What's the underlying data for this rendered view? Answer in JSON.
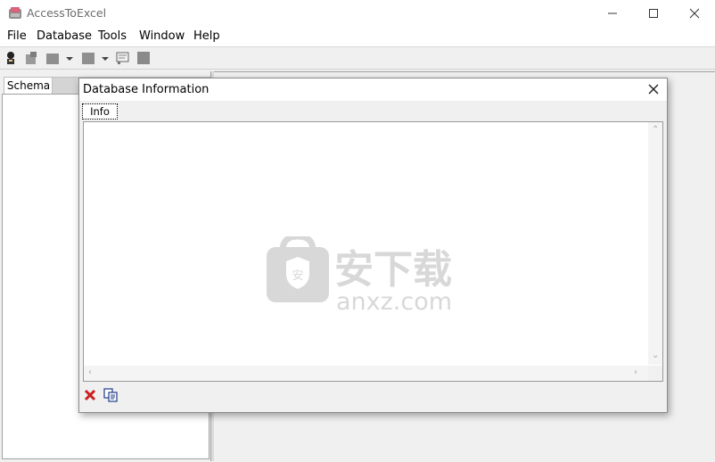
{
  "window": {
    "title": "AccessToExcel",
    "controls": [
      "minimize",
      "maximize",
      "close"
    ]
  },
  "menu": {
    "items": [
      "File",
      "Database",
      "Tools",
      "Window",
      "Help"
    ]
  },
  "toolbar": {
    "icons": [
      "connect-icon",
      "disconnect-icon",
      "open-icon",
      "save-icon",
      "properties-icon",
      "stop-icon"
    ]
  },
  "left_pane": {
    "tab_label": "Schema"
  },
  "dialog": {
    "title": "Database Information",
    "tab_label": "Info",
    "content": "",
    "footer_icons": [
      "delete-icon",
      "copy-icon"
    ]
  },
  "watermark": {
    "cn_text": "安下载",
    "url_text": "anxz.com"
  },
  "colors": {
    "delete_red": "#cc1f1f",
    "watermark_gray": "#d8d8d8"
  }
}
